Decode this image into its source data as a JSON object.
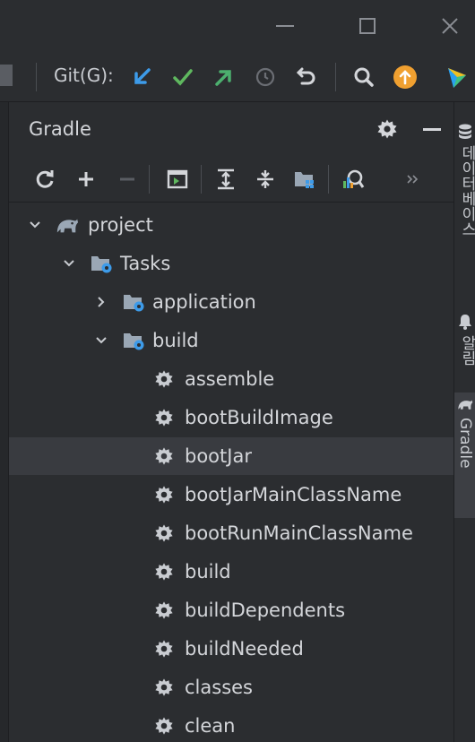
{
  "titlebar": {
    "minimize_icon": "minimize-icon",
    "maximize_icon": "maximize-icon",
    "close_icon": "close-icon"
  },
  "toolbar": {
    "git_label": "Git(G):",
    "icons": [
      "git-update-icon",
      "git-commit-icon",
      "git-push-icon",
      "history-icon",
      "rollback-icon",
      "search-icon",
      "update-available-icon",
      "ide-logo-icon"
    ],
    "colors": {
      "update": "#3d9be9",
      "commit": "#5fb85f",
      "push": "#4caf6e",
      "badge": "#f0a030"
    }
  },
  "panel": {
    "title": "Gradle",
    "header_icons": [
      "settings-gear-icon",
      "hide-panel-icon"
    ],
    "tool_icons": [
      "reload-icon",
      "add-icon",
      "remove-icon",
      "run-task-icon",
      "expand-all-icon",
      "collapse-all-icon",
      "group-modules-icon",
      "analyze-dependencies-icon",
      "more-chevron-icon"
    ]
  },
  "tree": {
    "project": "project",
    "tasks": "Tasks",
    "application": "application",
    "build": "build",
    "build_tasks": [
      "assemble",
      "bootBuildImage",
      "bootJar",
      "bootJarMainClassName",
      "bootRunMainClassName",
      "build",
      "buildDependents",
      "buildNeeded",
      "classes",
      "clean"
    ],
    "selected": "bootJar"
  },
  "stripe": {
    "database_label": "데이터베이스",
    "notifications_label": "알림",
    "gradle_label": "Gradle"
  }
}
